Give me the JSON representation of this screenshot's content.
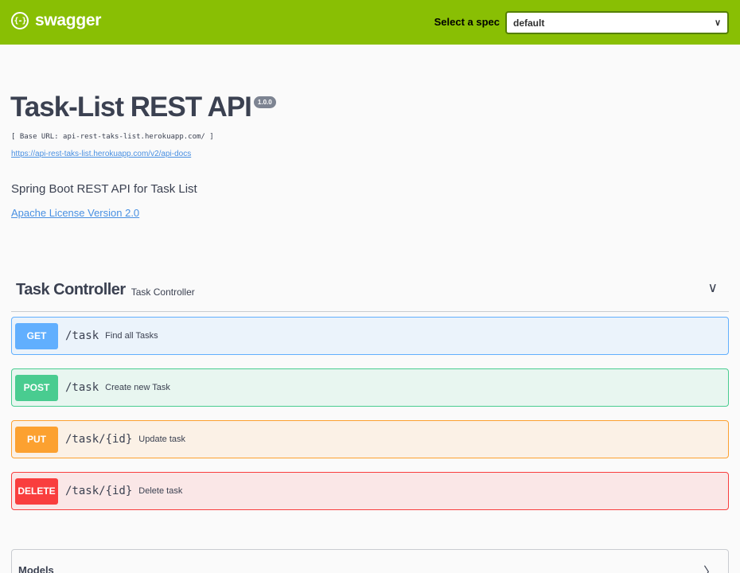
{
  "topbar": {
    "logo_icon": "{-}",
    "logo_text": "swagger",
    "spec_label": "Select a spec",
    "spec_value": "default",
    "spec_chevron": "∨",
    "colors": {
      "background": "#89bf04"
    }
  },
  "info": {
    "title": "Task-List REST API",
    "version": "1.0.0",
    "base_url": "[ Base URL: api-rest-taks-list.herokuapp.com/ ]",
    "docs_link": "https://api-rest-taks-list.herokuapp.com/v2/api-docs",
    "description": "Spring Boot REST API for Task List",
    "license": "Apache License Version 2.0"
  },
  "tag": {
    "name": "Task Controller",
    "description": "Task Controller",
    "chevron": "∨"
  },
  "operations": [
    {
      "method": "GET",
      "path": "/task",
      "summary": "Find all Tasks",
      "color": "#61affe"
    },
    {
      "method": "POST",
      "path": "/task",
      "summary": "Create new Task",
      "color": "#49cc90"
    },
    {
      "method": "PUT",
      "path": "/task/{id}",
      "summary": "Update task",
      "color": "#fca130"
    },
    {
      "method": "DELETE",
      "path": "/task/{id}",
      "summary": "Delete task",
      "color": "#f93e3e"
    }
  ],
  "models": {
    "label": "Models",
    "chevron": "〉"
  }
}
